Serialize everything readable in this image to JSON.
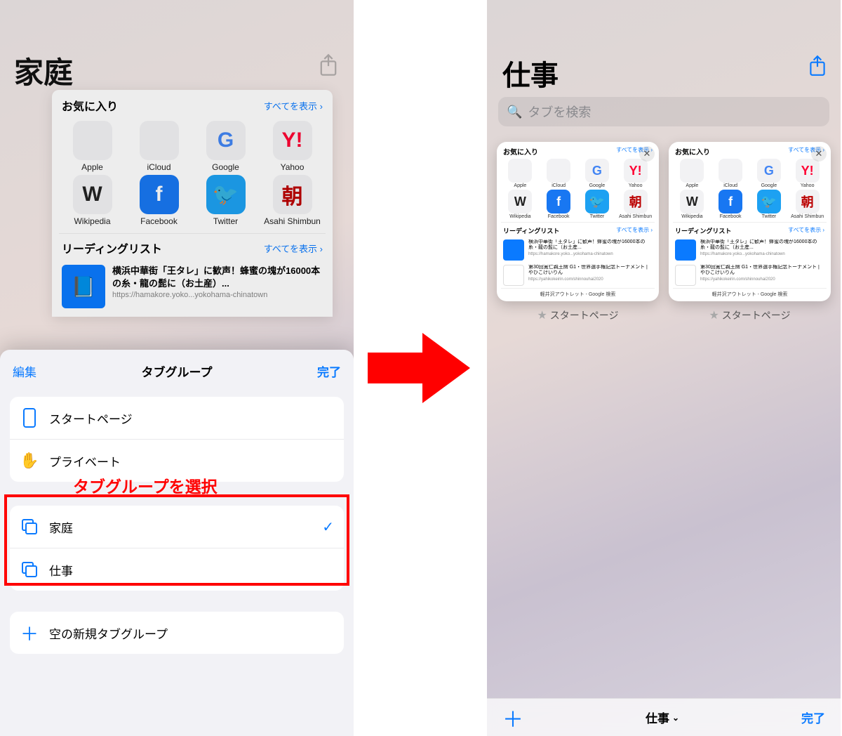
{
  "left": {
    "title": "家庭",
    "favorites_header": "お気に入り",
    "show_all": "すべてを表示",
    "favorites": [
      {
        "label": "Apple",
        "glyph": ""
      },
      {
        "label": "iCloud",
        "glyph": ""
      },
      {
        "label": "Google",
        "glyph": "G"
      },
      {
        "label": "Yahoo",
        "glyph": "Y!"
      },
      {
        "label": "Wikipedia",
        "glyph": "W"
      },
      {
        "label": "Facebook",
        "glyph": "f"
      },
      {
        "label": "Twitter",
        "glyph": "🐦"
      },
      {
        "label": "Asahi Shimbun",
        "glyph": "朝"
      }
    ],
    "reading_header": "リーディングリスト",
    "reading_title": "横浜中華街「王タレ」に歓声！蜂蜜の塊が16000本の糸・龍の髭に（お土産）...",
    "reading_url": "https://hamakore.yoko...yokohama-chinatown",
    "sheet": {
      "edit": "編集",
      "title": "タブグループ",
      "done": "完了",
      "rows1": [
        {
          "icon": "phone",
          "label": "スタートページ"
        },
        {
          "icon": "hand",
          "label": "プライベート"
        }
      ],
      "rows2": [
        {
          "icon": "stack",
          "label": "家庭",
          "checked": true
        },
        {
          "icon": "stack",
          "label": "仕事",
          "checked": false
        }
      ],
      "new_group": "空の新規タブグループ"
    },
    "annotation": "タブグループを選択"
  },
  "right": {
    "title": "仕事",
    "search_placeholder": "タブを検索",
    "tab_caption": "スタートページ",
    "mini": {
      "fav_header": "お気に入り",
      "show_all": "すべてを表示 ›",
      "favorites": [
        {
          "label": "Apple",
          "glyph": ""
        },
        {
          "label": "iCloud",
          "glyph": ""
        },
        {
          "label": "Google",
          "glyph": "G"
        },
        {
          "label": "Yahoo",
          "glyph": "Y!"
        },
        {
          "label": "Wikipedia",
          "glyph": "W"
        },
        {
          "label": "Facebook",
          "glyph": "f"
        },
        {
          "label": "Twitter",
          "glyph": "🐦"
        },
        {
          "label": "Asahi Shimbun",
          "glyph": "朝"
        }
      ],
      "reading_header": "リーディングリスト",
      "reading1_title": "横浜中華街「王タレ」に歓声！蜂蜜の塊が16000本の糸・龍の髭に（お土産...",
      "reading1_url": "https://hamakore.yoko...yokohama-chinatown",
      "reading2_title": "第30回寛仁親王牌 G1・世界選手権記念トーナメント | やひこけいりん",
      "reading2_url": "https://yahikokeirin.com/shinnouhai2020",
      "footer": "軽井沢アウトレット - Google 検索"
    },
    "bottombar": {
      "center": "仕事",
      "done": "完了"
    }
  }
}
